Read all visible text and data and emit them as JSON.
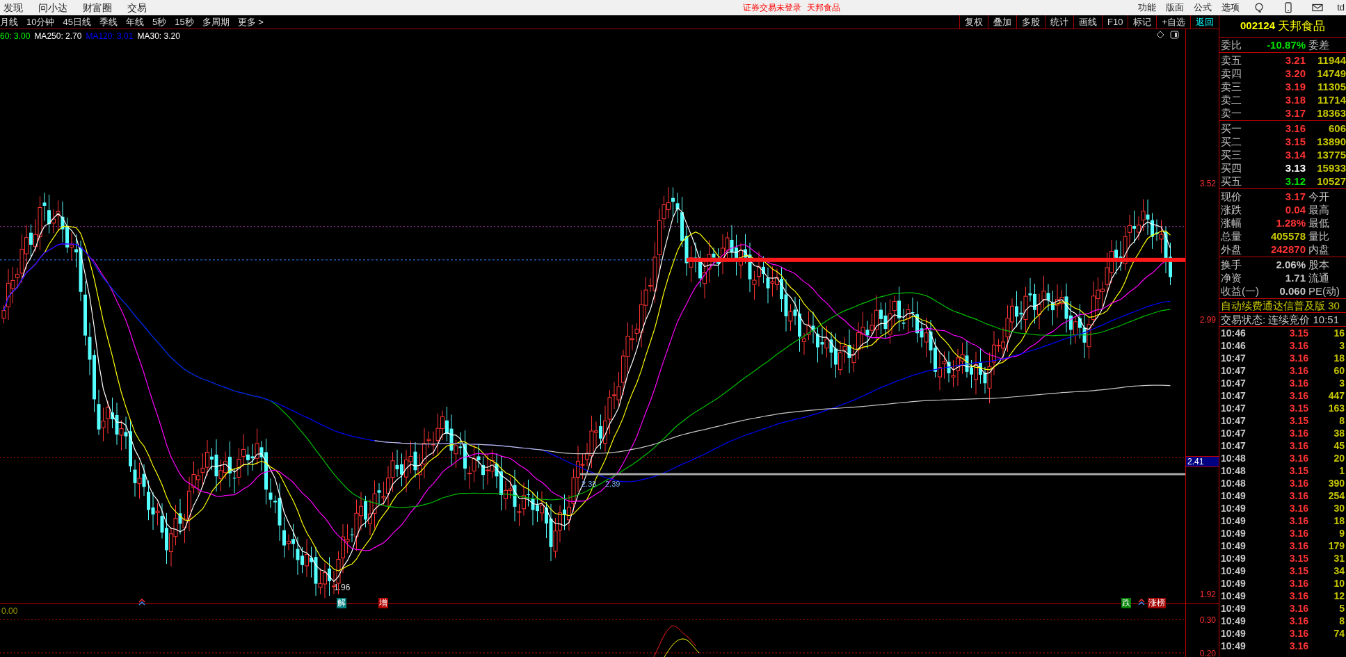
{
  "menu_bar": {
    "items": [
      "发现",
      "问小达",
      "财富圈",
      "交易"
    ],
    "notice": "证券交易未登录",
    "stock_name": "天邦食品",
    "right_items": [
      "功能",
      "版面",
      "公式",
      "选项"
    ],
    "user": "td"
  },
  "period_bar": {
    "items": [
      "月线",
      "10分钟",
      "45日线",
      "季线",
      "年线",
      "5秒",
      "15秒",
      "多周期",
      "更多 >"
    ]
  },
  "toolbar": {
    "buttons": [
      {
        "label": "复权",
        "active": false
      },
      {
        "label": "叠加",
        "active": false
      },
      {
        "label": "多股",
        "active": false
      },
      {
        "label": "统计",
        "active": false
      },
      {
        "label": "画线",
        "active": false
      },
      {
        "label": "F10",
        "active": false
      },
      {
        "label": "标记",
        "active": false
      },
      {
        "label": "+自选",
        "active": false
      },
      {
        "label": "返回",
        "active": true
      }
    ]
  },
  "ma_legend": [
    {
      "label": "60: 3.00",
      "color": "#00ff00"
    },
    {
      "label": "MA250: 2.70",
      "color": "#ffffff"
    },
    {
      "label": "MA120: 3.01",
      "color": "#0000ff"
    },
    {
      "label": "MA30: 3.20",
      "color": "#ffffff"
    }
  ],
  "chart": {
    "price_axis": [
      "3.52",
      "2.99",
      "1.92"
    ],
    "price_tag": "2.41",
    "low_label": "1.96",
    "gap_labels": [
      "2.38",
      "2.39"
    ],
    "markers": [
      {
        "text": "解",
        "color": "#008080"
      },
      {
        "text": "增",
        "color": "#b00000"
      },
      {
        "text": "跌",
        "color": "#008000"
      },
      {
        "text": "涨榜",
        "color": "#a00000"
      }
    ]
  },
  "indicator_pane": {
    "value": "0.00",
    "axis": [
      "0.30",
      "0.20"
    ]
  },
  "quote_panel": {
    "code": "002124",
    "name": "天邦食品",
    "ratio": {
      "label": "委比",
      "value": "-10.87%",
      "label2": "委差"
    },
    "asks": [
      {
        "label": "卖五",
        "price": "3.21",
        "volume": "11944",
        "color": "#ff3333"
      },
      {
        "label": "卖四",
        "price": "3.20",
        "volume": "14749",
        "color": "#ff3333"
      },
      {
        "label": "卖三",
        "price": "3.19",
        "volume": "11305",
        "color": "#ff3333"
      },
      {
        "label": "卖二",
        "price": "3.18",
        "volume": "11714",
        "color": "#ff3333"
      },
      {
        "label": "卖一",
        "price": "3.17",
        "volume": "18363",
        "color": "#ff3333"
      }
    ],
    "bids": [
      {
        "label": "买一",
        "price": "3.16",
        "volume": "606",
        "color": "#ff3333"
      },
      {
        "label": "买二",
        "price": "3.15",
        "volume": "13890",
        "color": "#ff3333"
      },
      {
        "label": "买三",
        "price": "3.14",
        "volume": "13775",
        "color": "#ff3333"
      },
      {
        "label": "买四",
        "price": "3.13",
        "volume": "15933",
        "color": "#ffffff"
      },
      {
        "label": "买五",
        "price": "3.12",
        "volume": "10527",
        "color": "#00e000"
      }
    ],
    "stats": [
      {
        "label": "现价",
        "value": "3.17",
        "label2": "今开",
        "color": "#ff3333"
      },
      {
        "label": "涨跌",
        "value": "0.04",
        "label2": "最高",
        "color": "#ff3333"
      },
      {
        "label": "涨幅",
        "value": "1.28%",
        "label2": "最低",
        "color": "#ff3333"
      },
      {
        "label": "总量",
        "value": "405578",
        "label2": "量比",
        "color": "#c8c800"
      },
      {
        "label": "外盘",
        "value": "242870",
        "label2": "内盘",
        "color": "#ff3333"
      }
    ],
    "info": [
      {
        "label": "换手",
        "value": "2.06%",
        "label2": "股本"
      },
      {
        "label": "净资",
        "value": "1.71",
        "label2": "流通"
      },
      {
        "label": "收益(一)",
        "value": "0.060",
        "label2": "PE(动)"
      }
    ],
    "notice_line": "自动续费通达信普及版 30",
    "trade_status": "交易状态: 连续竞价 10:51",
    "ticks": [
      {
        "time": "10:46",
        "price": "3.15",
        "volume": "16"
      },
      {
        "time": "10:46",
        "price": "3.16",
        "volume": "3"
      },
      {
        "time": "10:47",
        "price": "3.16",
        "volume": "18"
      },
      {
        "time": "10:47",
        "price": "3.16",
        "volume": "60"
      },
      {
        "time": "10:47",
        "price": "3.16",
        "volume": "3"
      },
      {
        "time": "10:47",
        "price": "3.16",
        "volume": "447"
      },
      {
        "time": "10:47",
        "price": "3.15",
        "volume": "163"
      },
      {
        "time": "10:47",
        "price": "3.15",
        "volume": "8"
      },
      {
        "time": "10:47",
        "price": "3.16",
        "volume": "38"
      },
      {
        "time": "10:47",
        "price": "3.16",
        "volume": "45"
      },
      {
        "time": "10:48",
        "price": "3.16",
        "volume": "20"
      },
      {
        "time": "10:48",
        "price": "3.15",
        "volume": "1"
      },
      {
        "time": "10:48",
        "price": "3.16",
        "volume": "390"
      },
      {
        "time": "10:49",
        "price": "3.16",
        "volume": "254"
      },
      {
        "time": "10:49",
        "price": "3.16",
        "volume": "30"
      },
      {
        "time": "10:49",
        "price": "3.16",
        "volume": "18"
      },
      {
        "time": "10:49",
        "price": "3.16",
        "volume": "9"
      },
      {
        "time": "10:49",
        "price": "3.16",
        "volume": "179"
      },
      {
        "time": "10:49",
        "price": "3.15",
        "volume": "31"
      },
      {
        "time": "10:49",
        "price": "3.15",
        "volume": "34"
      },
      {
        "time": "10:49",
        "price": "3.16",
        "volume": "10"
      },
      {
        "time": "10:49",
        "price": "3.16",
        "volume": "12"
      },
      {
        "time": "10:49",
        "price": "3.16",
        "volume": "5"
      },
      {
        "time": "10:49",
        "price": "3.16",
        "volume": "8"
      },
      {
        "time": "10:49",
        "price": "3.16",
        "volume": "74"
      },
      {
        "time": "10:49",
        "price": "3.16"
      }
    ]
  }
}
